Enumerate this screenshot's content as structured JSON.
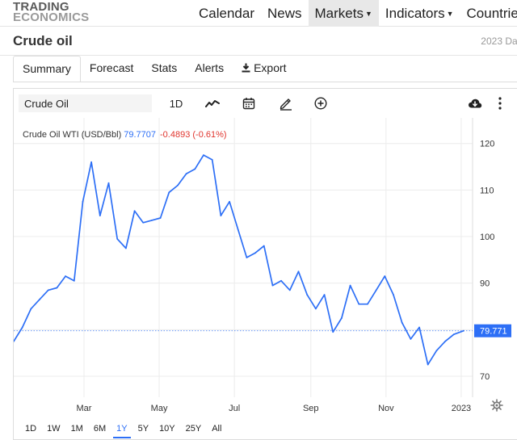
{
  "header": {
    "logo_line1": "TRADING",
    "logo_line2": "ECONOMICS",
    "nav": [
      {
        "label": "Calendar",
        "active": false,
        "caret": false
      },
      {
        "label": "News",
        "active": false,
        "caret": false
      },
      {
        "label": "Markets",
        "active": true,
        "caret": true
      },
      {
        "label": "Indicators",
        "active": false,
        "caret": true
      },
      {
        "label": "Countrie",
        "active": false,
        "caret": false
      }
    ]
  },
  "page": {
    "title": "Crude oil",
    "date_text": "2023 Dat"
  },
  "tabs": [
    {
      "label": "Summary",
      "active": true
    },
    {
      "label": "Forecast",
      "active": false
    },
    {
      "label": "Stats",
      "active": false
    },
    {
      "label": "Alerts",
      "active": false
    },
    {
      "label": "Export",
      "active": false,
      "icon": "download-icon"
    }
  ],
  "toolbar": {
    "symbol_value": "Crude Oil",
    "interval_label": "1D",
    "icons": [
      "line-chart-icon",
      "calendar-icon",
      "pencil-draw-icon",
      "add-circle-icon",
      "cloud-download-icon",
      "more-vertical-icon"
    ]
  },
  "legend": {
    "name": "Crude Oil WTI (USD/Bbl)",
    "last": "79.7707",
    "change": "-0.4893 (-0.61%)"
  },
  "colors": {
    "line": "#2d6ff6",
    "negative": "#e0342d",
    "accent": "#2d6ff6",
    "grid": "#ececec"
  },
  "chart_data": {
    "type": "line",
    "series": [
      {
        "name": "Crude Oil WTI (USD/Bbl)",
        "x": [
          "2022-01-03",
          "2022-01-10",
          "2022-01-17",
          "2022-01-24",
          "2022-01-31",
          "2022-02-07",
          "2022-02-14",
          "2022-02-21",
          "2022-02-28",
          "2022-03-07",
          "2022-03-14",
          "2022-03-21",
          "2022-03-28",
          "2022-04-04",
          "2022-04-11",
          "2022-04-18",
          "2022-04-25",
          "2022-05-02",
          "2022-05-09",
          "2022-05-16",
          "2022-05-23",
          "2022-05-30",
          "2022-06-06",
          "2022-06-13",
          "2022-06-20",
          "2022-06-27",
          "2022-07-04",
          "2022-07-11",
          "2022-07-18",
          "2022-07-25",
          "2022-08-01",
          "2022-08-08",
          "2022-08-15",
          "2022-08-22",
          "2022-08-29",
          "2022-09-05",
          "2022-09-12",
          "2022-09-19",
          "2022-09-26",
          "2022-10-03",
          "2022-10-10",
          "2022-10-17",
          "2022-10-24",
          "2022-10-31",
          "2022-11-07",
          "2022-11-14",
          "2022-11-21",
          "2022-11-28",
          "2022-12-05",
          "2022-12-12",
          "2022-12-19",
          "2022-12-26",
          "2023-01-03"
        ],
        "y": [
          77.5,
          80.5,
          84.5,
          86.5,
          88.5,
          89.0,
          91.5,
          90.5,
          107.5,
          116.0,
          104.5,
          111.5,
          99.5,
          97.5,
          105.5,
          103.0,
          103.5,
          104.0,
          109.5,
          111.0,
          113.5,
          114.5,
          117.5,
          116.5,
          104.5,
          107.5,
          101.5,
          95.5,
          96.5,
          98.0,
          89.5,
          90.5,
          88.5,
          92.5,
          87.5,
          84.5,
          87.5,
          79.5,
          82.5,
          89.5,
          85.5,
          85.5,
          88.5,
          91.5,
          87.5,
          81.5,
          78.0,
          80.5,
          72.5,
          75.5,
          77.5,
          79.0,
          79.77
        ]
      }
    ],
    "x_tick_labels": [
      "Mar",
      "May",
      "Jul",
      "Sep",
      "Nov",
      "2023"
    ],
    "y_tick_labels": [
      "120",
      "110",
      "100",
      "90",
      "80",
      "70"
    ],
    "ylim": [
      65.5,
      125.5
    ],
    "last_value_label": "79.771",
    "grid": true,
    "title": "",
    "xlabel": "",
    "ylabel": ""
  },
  "ranges": [
    {
      "label": "1D",
      "active": false
    },
    {
      "label": "1W",
      "active": false
    },
    {
      "label": "1M",
      "active": false
    },
    {
      "label": "6M",
      "active": false
    },
    {
      "label": "1Y",
      "active": true
    },
    {
      "label": "5Y",
      "active": false
    },
    {
      "label": "10Y",
      "active": false
    },
    {
      "label": "25Y",
      "active": false
    },
    {
      "label": "All",
      "active": false
    }
  ]
}
